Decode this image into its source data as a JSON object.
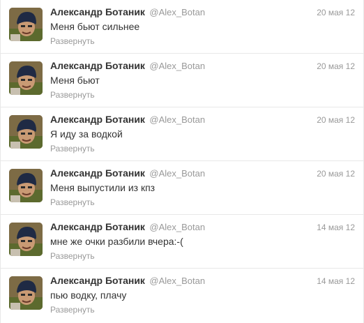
{
  "tweets": [
    {
      "fullname": "Александр Ботаник",
      "username": "@Alex_Botan",
      "time": "20 мая 12",
      "text": "Меня бьют сильнее",
      "expand": "Развернуть"
    },
    {
      "fullname": "Александр Ботаник",
      "username": "@Alex_Botan",
      "time": "20 мая 12",
      "text": "Меня бьют",
      "expand": "Развернуть"
    },
    {
      "fullname": "Александр Ботаник",
      "username": "@Alex_Botan",
      "time": "20 мая 12",
      "text": "Я иду за водкой",
      "expand": "Развернуть"
    },
    {
      "fullname": "Александр Ботаник",
      "username": "@Alex_Botan",
      "time": "20 мая 12",
      "text": "Меня выпустили из кпз",
      "expand": "Развернуть"
    },
    {
      "fullname": "Александр Ботаник",
      "username": "@Alex_Botan",
      "time": "14 мая 12",
      "text": "мне же очки разбили вчера:-(",
      "expand": "Развернуть"
    },
    {
      "fullname": "Александр Ботаник",
      "username": "@Alex_Botan",
      "time": "14 мая 12",
      "text": "пью водку, плачу",
      "expand": "Развернуть"
    }
  ]
}
